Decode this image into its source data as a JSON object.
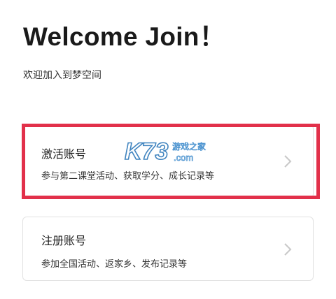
{
  "header": {
    "title": "Welcome Join！",
    "subtitle": "欢迎加入到梦空间"
  },
  "cards": [
    {
      "title": "激活账号",
      "description": "参与第二课堂活动、获取学分、成长记录等",
      "chevron_icon": "chevron-right-icon"
    },
    {
      "title": "注册账号",
      "description": "参加全国活动、返家乡、发布记录等",
      "chevron_icon": "chevron-right-icon"
    }
  ],
  "watermark": {
    "text_main": "K73",
    "text_sub": "游戏之家",
    "text_domain": ".com"
  },
  "colors": {
    "highlight": "#e2304a",
    "card_border": "#e2e2e2",
    "chevron": "#c8c8c8"
  }
}
